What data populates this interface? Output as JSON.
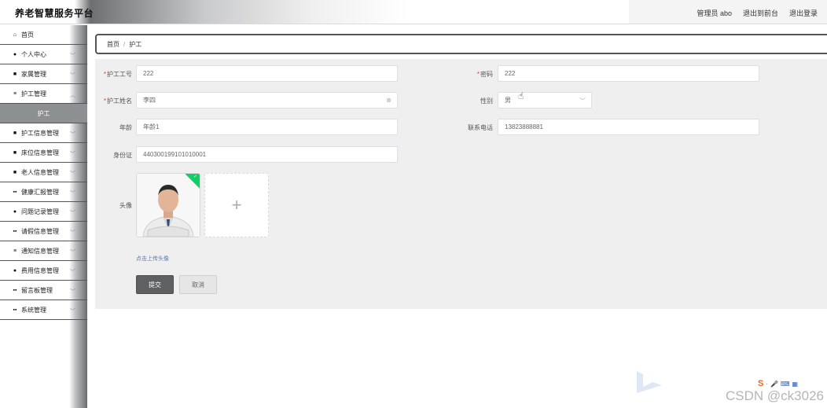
{
  "app": {
    "title": "养老智慧服务平台"
  },
  "header": {
    "user_label": "管理员 abo",
    "front_label": "退出到前台",
    "logout_label": "退出登录"
  },
  "sidebar": {
    "items": [
      {
        "label": "首页",
        "icon": "home-icon",
        "glyph": "⌂",
        "chevron": false
      },
      {
        "label": "个人中心",
        "icon": "user-icon",
        "glyph": "●",
        "chevron": true
      },
      {
        "label": "家属管理",
        "icon": "doc-icon",
        "glyph": "■",
        "chevron": true
      },
      {
        "label": "护工管理",
        "icon": "list-icon",
        "glyph": "≡",
        "chevron": true
      }
    ],
    "sub_active": "护工",
    "items2": [
      {
        "label": "护工信息管理",
        "icon": "card-icon",
        "glyph": "■",
        "chevron": true
      },
      {
        "label": "床位信息管理",
        "icon": "doc-icon",
        "glyph": "■",
        "chevron": true
      },
      {
        "label": "老人信息管理",
        "icon": "card-icon",
        "glyph": "■",
        "chevron": true
      },
      {
        "label": "健康汇报管理",
        "icon": "grid-icon",
        "glyph": "▪▪",
        "chevron": true
      },
      {
        "label": "问题记录管理",
        "icon": "user-icon",
        "glyph": "●",
        "chevron": true
      },
      {
        "label": "请假信息管理",
        "icon": "grid-icon",
        "glyph": "▪▪",
        "chevron": true
      },
      {
        "label": "通知信息管理",
        "icon": "list-icon",
        "glyph": "≡",
        "chevron": true
      },
      {
        "label": "费用信息管理",
        "icon": "user-icon",
        "glyph": "●",
        "chevron": true
      },
      {
        "label": "留言板管理",
        "icon": "grid-icon",
        "glyph": "▪▪",
        "chevron": true
      },
      {
        "label": "系统管理",
        "icon": "grid-icon",
        "glyph": "▪▪",
        "chevron": true
      }
    ]
  },
  "breadcrumb": {
    "home": "首页",
    "sep": "/",
    "current": "护工"
  },
  "form": {
    "worker_id": {
      "label": "护工工号",
      "value": "222"
    },
    "password": {
      "label": "密码",
      "value": "222"
    },
    "worker_name": {
      "label": "护工姓名",
      "value": "李四"
    },
    "gender": {
      "label": "性别",
      "value": "男"
    },
    "age": {
      "label": "年龄",
      "value": "年龄1"
    },
    "phone": {
      "label": "联系电话",
      "value": "13823888881"
    },
    "id_card": {
      "label": "身份证",
      "value": "440300199101010001"
    },
    "avatar": {
      "label": "头像",
      "hint": "点击上传头像"
    },
    "submit_label": "提交",
    "cancel_label": "取消"
  },
  "watermark": {
    "text": "CSDN @ck3026"
  },
  "colors": {
    "accent_dark": "#5f6062",
    "success": "#13ce66",
    "required": "#e04040"
  }
}
